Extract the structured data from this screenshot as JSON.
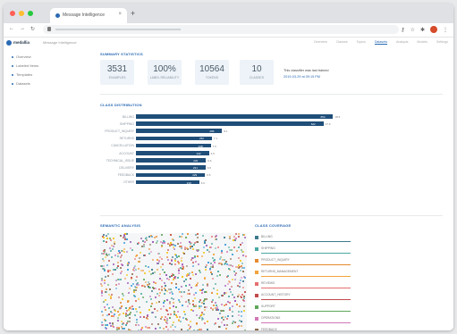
{
  "browser": {
    "tab_title": "Message Intelligence",
    "new_tab": "+",
    "tab_close": "×"
  },
  "app": {
    "brand": "medallia",
    "crumb": "Message Intelligence",
    "nav": [
      "Overview",
      "Classes",
      "Topics",
      "Datasets",
      "Analysis",
      "Models",
      "Settings"
    ],
    "active_nav": "Datasets"
  },
  "sidebar": {
    "items": [
      "Overview",
      "Labeled Items",
      "Templates",
      "Datasets"
    ]
  },
  "summary": {
    "title": "SUMMARY STATISTICS",
    "stats": [
      {
        "value": "3531",
        "label": "EXAMPLES"
      },
      {
        "value": "100%",
        "label": "LABEL RELIABILITY"
      },
      {
        "value": "10564",
        "label": "TOKENS"
      },
      {
        "value": "10",
        "label": "CLASSES"
      }
    ],
    "note": "This classifier was last trained",
    "note_link": "2019-03-29 at 09:15 PM"
  },
  "distribution": {
    "title": "CLASS DISTRIBUTION"
  },
  "chart_data": {
    "type": "bar",
    "orientation": "horizontal",
    "title": "CLASS DISTRIBUTION",
    "categories": [
      "BILLING",
      "SHIPPING",
      "PRODUCT_INQUIRY",
      "RETURNS",
      "CANCELLATION",
      "ACCOUNT",
      "TECHNICAL_ISSUE",
      "DELIVERY",
      "FEEDBACK",
      "OTHER"
    ],
    "values": [
      654,
      622,
      286,
      252,
      248,
      242,
      232,
      231,
      229,
      210
    ],
    "end_labels": [
      "18.5",
      "17.6",
      "8.1",
      "7.1",
      "7.0",
      "6.9",
      "6.6",
      "6.5",
      "6.5",
      "6.0"
    ],
    "xlim": [
      0,
      700
    ],
    "color": "#1f4e79"
  },
  "semantic": {
    "title": "SEMANTIC ANALYSIS"
  },
  "coverage": {
    "title": "CLASS COVERAGE",
    "items": [
      {
        "label": "BILLING",
        "color": "#3d7a8c",
        "fill": 1.0
      },
      {
        "label": "SHIPPING",
        "color": "#4aa9a1",
        "fill": 1.0
      },
      {
        "label": "PRODUCT_INQUIRY",
        "color": "#e58a2e",
        "fill": 1.0
      },
      {
        "label": "RETURNS_MANAGEMENT",
        "color": "#f2a23b",
        "fill": 1.0
      },
      {
        "label": "REVIEWS",
        "color": "#e66f6f",
        "fill": 1.0
      },
      {
        "label": "ACCOUNT_HISTORY",
        "color": "#c14a4a",
        "fill": 1.0
      },
      {
        "label": "SUPPORT",
        "color": "#5fa65a",
        "fill": 1.0
      },
      {
        "label": "OPERATIONS",
        "color": "#d277b8",
        "fill": 1.0
      },
      {
        "label": "FEEDBACK",
        "color": "#8c6b4d",
        "fill": 1.0
      }
    ]
  },
  "colors": {
    "accent": "#2a6ab3",
    "bar": "#1f4e79",
    "stat_bg": "#edf3f8"
  }
}
